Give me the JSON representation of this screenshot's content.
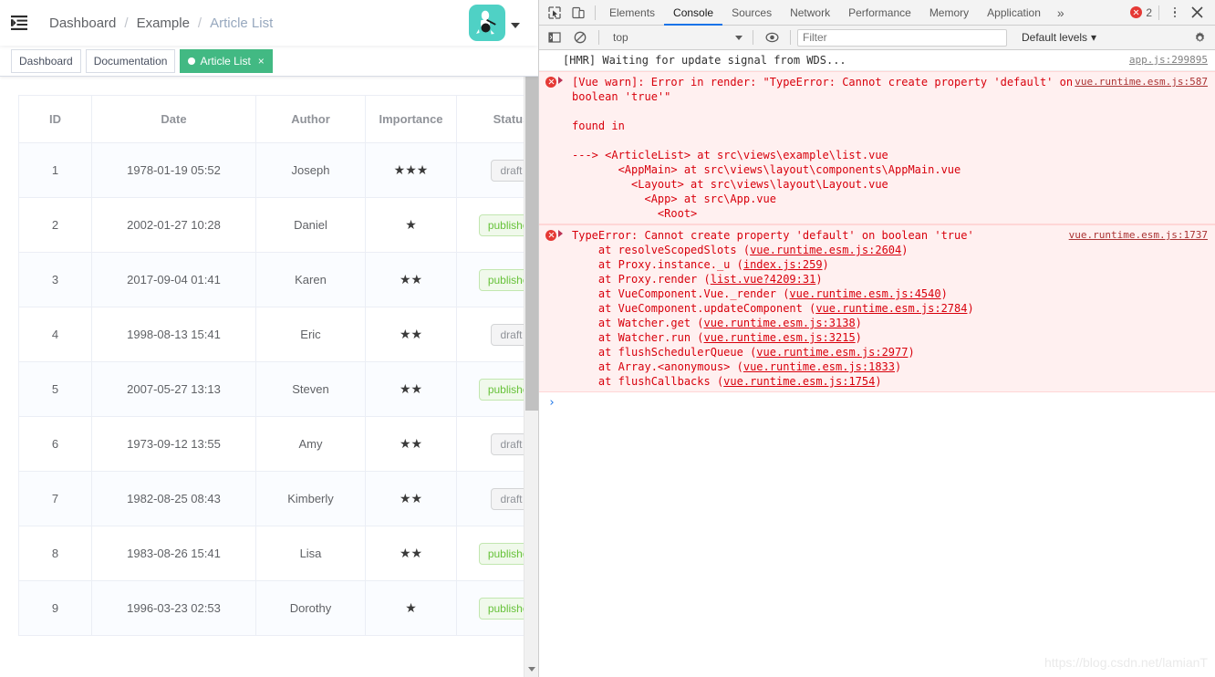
{
  "page": {
    "navbar": {
      "hamburger_icon": "menu-fold-icon",
      "breadcrumb": [
        {
          "label": "Dashboard",
          "active": false
        },
        {
          "label": "Example",
          "active": false
        },
        {
          "label": "Article List",
          "active": true
        }
      ],
      "separator": "/",
      "avatar_icon": "user-avatar",
      "caret_icon": "caret-down-icon"
    },
    "tags_view": [
      {
        "label": "Dashboard",
        "active": false,
        "closable": false
      },
      {
        "label": "Documentation",
        "active": false,
        "closable": false
      },
      {
        "label": "Article List",
        "active": true,
        "closable": true,
        "close_label": "×"
      }
    ],
    "table": {
      "columns": [
        "ID",
        "Date",
        "Author",
        "Importance",
        "Status"
      ],
      "rows": [
        {
          "id": "1",
          "date": "1978-01-19 05:52",
          "author": "Joseph",
          "importance": 3,
          "status": "draft",
          "status_type": "info"
        },
        {
          "id": "2",
          "date": "2002-01-27 10:28",
          "author": "Daniel",
          "importance": 1,
          "status": "published",
          "status_type": "success"
        },
        {
          "id": "3",
          "date": "2017-09-04 01:41",
          "author": "Karen",
          "importance": 2,
          "status": "published",
          "status_type": "success"
        },
        {
          "id": "4",
          "date": "1998-08-13 15:41",
          "author": "Eric",
          "importance": 2,
          "status": "draft",
          "status_type": "info"
        },
        {
          "id": "5",
          "date": "2007-05-27 13:13",
          "author": "Steven",
          "importance": 2,
          "status": "published",
          "status_type": "success"
        },
        {
          "id": "6",
          "date": "1973-09-12 13:55",
          "author": "Amy",
          "importance": 2,
          "status": "draft",
          "status_type": "info"
        },
        {
          "id": "7",
          "date": "1982-08-25 08:43",
          "author": "Kimberly",
          "importance": 2,
          "status": "draft",
          "status_type": "info"
        },
        {
          "id": "8",
          "date": "1983-08-26 15:41",
          "author": "Lisa",
          "importance": 2,
          "status": "published",
          "status_type": "success"
        },
        {
          "id": "9",
          "date": "1996-03-23 02:53",
          "author": "Dorothy",
          "importance": 1,
          "status": "published",
          "status_type": "success"
        }
      ],
      "star_glyph": "★"
    },
    "scrollbar": {
      "up_icon": "scroll-up-arrow-icon",
      "down_icon": "scroll-down-arrow-icon"
    }
  },
  "devtools": {
    "toolbar": {
      "inspect_icon": "inspect-element-icon",
      "device_icon": "toggle-device-toolbar-icon",
      "tabs": [
        {
          "label": "Elements",
          "active": false
        },
        {
          "label": "Console",
          "active": true
        },
        {
          "label": "Sources",
          "active": false
        },
        {
          "label": "Network",
          "active": false
        },
        {
          "label": "Performance",
          "active": false
        },
        {
          "label": "Memory",
          "active": false
        },
        {
          "label": "Application",
          "active": false
        }
      ],
      "more_label": "»",
      "error_count": "2",
      "error_icon": "error-circle-icon",
      "menu_icon": "more-vertical-icon",
      "close_icon": "close-icon"
    },
    "filterbar": {
      "sidebar_icon": "console-sidebar-icon",
      "clear_icon": "clear-console-icon",
      "context": "top",
      "eye_icon": "live-expression-icon",
      "filter_placeholder": "Filter",
      "filter_value": "",
      "levels_label": "Default levels",
      "levels_caret": "▾",
      "settings_icon": "gear-icon"
    },
    "messages": [
      {
        "type": "info",
        "text": "[HMR] Waiting for update signal from WDS...",
        "source": "app.js:299895"
      },
      {
        "type": "error",
        "text": "[Vue warn]: Error in render: \"TypeError: Cannot create property 'default' on\nboolean 'true'\"\n\nfound in\n\n---> <ArticleList> at src\\views\\example\\list.vue\n       <AppMain> at src\\views\\layout\\components\\AppMain.vue\n         <Layout> at src\\views\\layout\\Layout.vue\n           <App> at src\\App.vue\n             <Root>",
        "source": "vue.runtime.esm.js:587"
      },
      {
        "type": "error",
        "text": "TypeError: Cannot create property 'default' on boolean 'true'\n    at resolveScopedSlots (vue.runtime.esm.js:2604)\n    at Proxy.instance._u (index.js:259)\n    at Proxy.render (list.vue?4209:31)\n    at VueComponent.Vue._render (vue.runtime.esm.js:4540)\n    at VueComponent.updateComponent (vue.runtime.esm.js:2784)\n    at Watcher.get (vue.runtime.esm.js:3138)\n    at Watcher.run (vue.runtime.esm.js:3215)\n    at flushSchedulerQueue (vue.runtime.esm.js:2977)\n    at Array.<anonymous> (vue.runtime.esm.js:1833)\n    at flushCallbacks (vue.runtime.esm.js:1754)",
        "source": "vue.runtime.esm.js:1737"
      }
    ],
    "prompt_symbol": "›"
  },
  "watermark": "https://blog.csdn.net/lamianT",
  "colors": {
    "accent_green": "#42b983",
    "avatar_teal": "#4fd1c5",
    "error_red": "#e53935",
    "devtools_blue": "#1a73e8"
  }
}
